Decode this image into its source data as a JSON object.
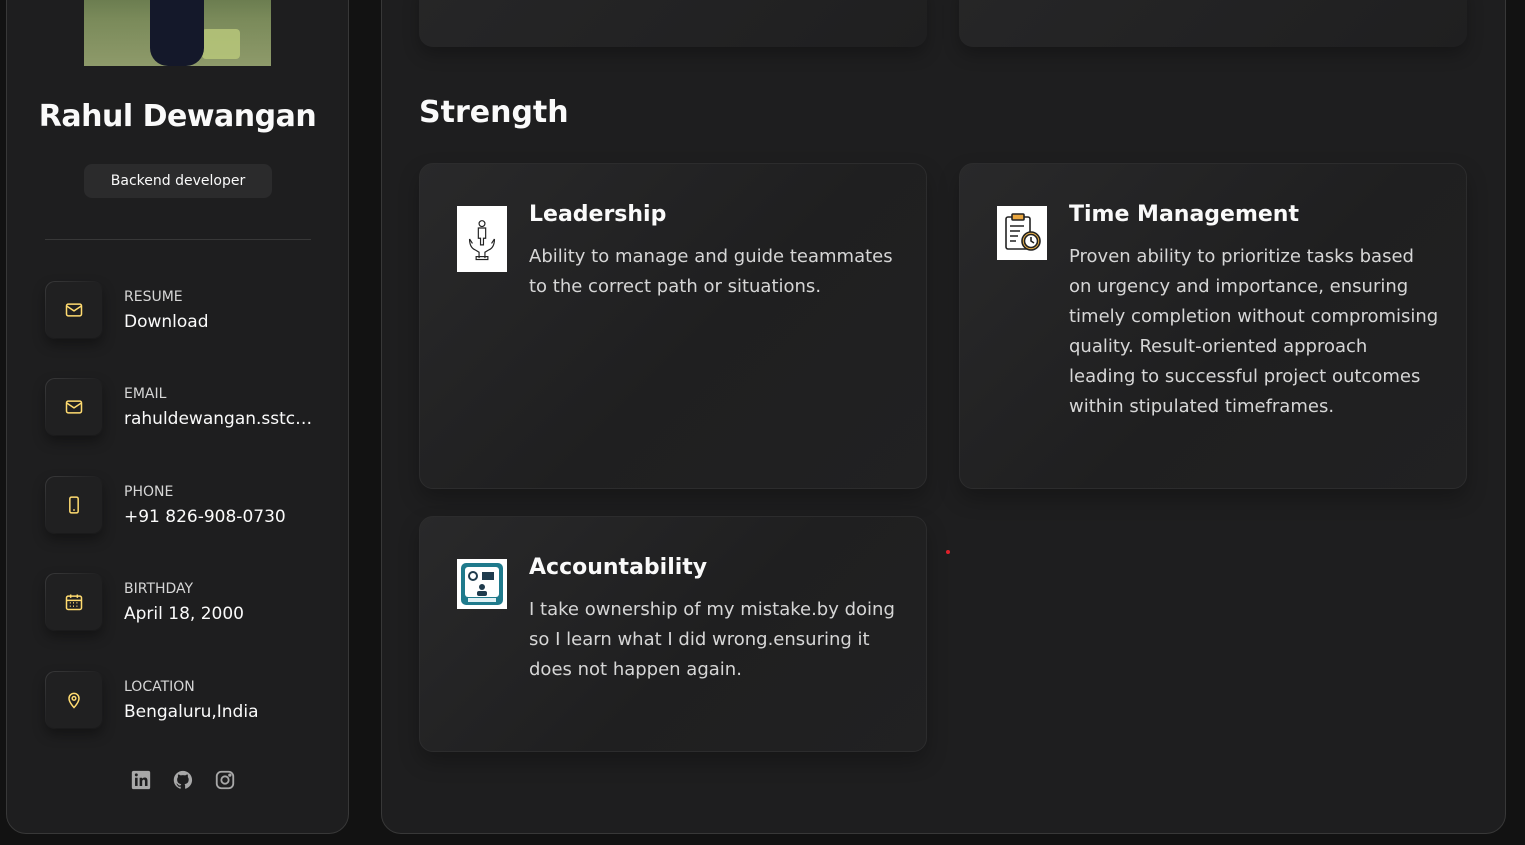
{
  "profile": {
    "name": "Rahul Dewangan",
    "title": "Backend developer"
  },
  "contacts": [
    {
      "icon": "mail-icon",
      "label": "RESUME",
      "value": "Download"
    },
    {
      "icon": "mail-icon",
      "label": "EMAIL",
      "value": "rahuldewangan.sstc…"
    },
    {
      "icon": "phone-icon",
      "label": "PHONE",
      "value": "+91 826-908-0730"
    },
    {
      "icon": "calendar-icon",
      "label": "BIRTHDAY",
      "value": "April 18, 2000"
    },
    {
      "icon": "location-icon",
      "label": "LOCATION",
      "value": "Bengaluru,India"
    }
  ],
  "social": [
    "linkedin-icon",
    "github-icon",
    "instagram-icon"
  ],
  "strength": {
    "heading": "Strength",
    "items": [
      {
        "icon": "leadership-icon",
        "title": "Leadership",
        "text": "Ability to manage and guide teammates to the correct path or situations."
      },
      {
        "icon": "time-management-icon",
        "title": "Time Management",
        "text": "Proven ability to prioritize tasks based on urgency and importance, ensuring timely completion without compromising quality. Result-oriented approach leading to successful project outcomes within stipulated timeframes."
      },
      {
        "icon": "accountability-icon",
        "title": "Accountability",
        "text": "I take ownership of my mistake.by doing so I learn what I did wrong.ensuring it does not happen again."
      }
    ]
  },
  "colors": {
    "accent": "#ffdb70",
    "background": "#121212",
    "panel": "#1e1e1f",
    "text": "#fafafa",
    "muted": "#d6d6d6"
  }
}
